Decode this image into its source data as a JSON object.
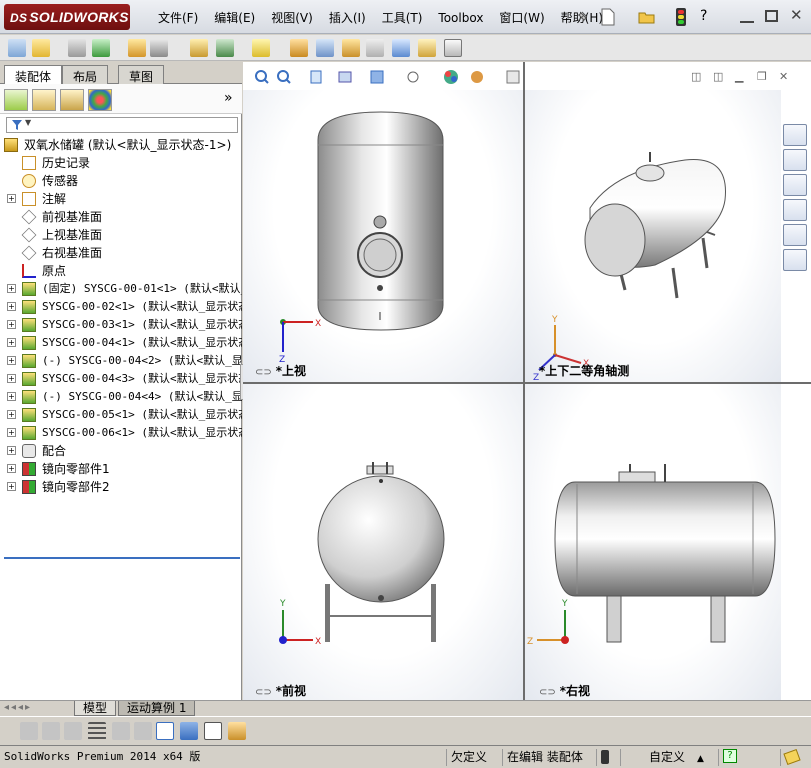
{
  "app": {
    "logo_text": "SOLIDWORKS",
    "logo_ds": "DS",
    "menus": [
      "文件(F)",
      "编辑(E)",
      "视图(V)",
      "插入(I)",
      "工具(T)",
      "Toolbox",
      "窗口(W)",
      "帮助(H)"
    ],
    "window_controls": [
      "—",
      "□",
      "✕"
    ]
  },
  "panel_tabs": [
    "装配体",
    "布局",
    "草图"
  ],
  "tree": [
    {
      "label": "双氧水储罐  (默认<默认_显示状态-1>)",
      "icon": "assembly-icon",
      "indent": 0,
      "expander": false
    },
    {
      "label": "历史记录",
      "icon": "history-icon",
      "indent": 1,
      "expander": false
    },
    {
      "label": "传感器",
      "icon": "sensor-icon",
      "indent": 1,
      "expander": false
    },
    {
      "label": "注解",
      "icon": "annotation-icon",
      "indent": 1,
      "expander": true
    },
    {
      "label": "前视基准面",
      "icon": "plane-icon",
      "indent": 1,
      "expander": false
    },
    {
      "label": "上视基准面",
      "icon": "plane-icon",
      "indent": 1,
      "expander": false
    },
    {
      "label": "右视基准面",
      "icon": "plane-icon",
      "indent": 1,
      "expander": false
    },
    {
      "label": "原点",
      "icon": "origin-icon",
      "indent": 1,
      "expander": false
    },
    {
      "label": "(固定) SYSCG-00-01<1> (默认<默认_",
      "icon": "part-icon",
      "indent": 1,
      "expander": true
    },
    {
      "label": "SYSCG-00-02<1> (默认<默认_显示状态",
      "icon": "part-icon",
      "indent": 1,
      "expander": true
    },
    {
      "label": "SYSCG-00-03<1> (默认<默认_显示状态",
      "icon": "part-icon",
      "indent": 1,
      "expander": true
    },
    {
      "label": "SYSCG-00-04<1> (默认<默认_显示状态",
      "icon": "part-icon",
      "indent": 1,
      "expander": true
    },
    {
      "label": "(-) SYSCG-00-04<2> (默认<默认_显示",
      "icon": "part-icon",
      "indent": 1,
      "expander": true
    },
    {
      "label": "SYSCG-00-04<3> (默认<默认_显示状态",
      "icon": "part-icon",
      "indent": 1,
      "expander": true
    },
    {
      "label": "(-) SYSCG-00-04<4> (默认<默认_显示",
      "icon": "part-icon",
      "indent": 1,
      "expander": true
    },
    {
      "label": "SYSCG-00-05<1> (默认<默认_显示状态",
      "icon": "part-icon",
      "indent": 1,
      "expander": true
    },
    {
      "label": "SYSCG-00-06<1> (默认<默认_显示状态",
      "icon": "part-icon",
      "indent": 1,
      "expander": true
    },
    {
      "label": "配合",
      "icon": "mates-icon",
      "indent": 1,
      "expander": true
    },
    {
      "label": "镜向零部件1",
      "icon": "mirror-icon",
      "indent": 1,
      "expander": true
    },
    {
      "label": "镜向零部件2",
      "icon": "mirror-icon",
      "indent": 1,
      "expander": true
    }
  ],
  "views": {
    "top": "*上视",
    "iso": "*上下二等角轴测",
    "front": "*前视",
    "right": "*右视",
    "axes": {
      "x": "X",
      "y": "Y",
      "z": "Z"
    }
  },
  "bottom_tabs": [
    "模型",
    "运动算例 1"
  ],
  "status": {
    "version": "SolidWorks Premium 2014 x64 版",
    "undefined": "欠定义",
    "editing": "在编辑 装配体",
    "custom": "自定义"
  },
  "colors": {
    "accent": "#3a6fc0",
    "logo": "#8a1a1a"
  }
}
